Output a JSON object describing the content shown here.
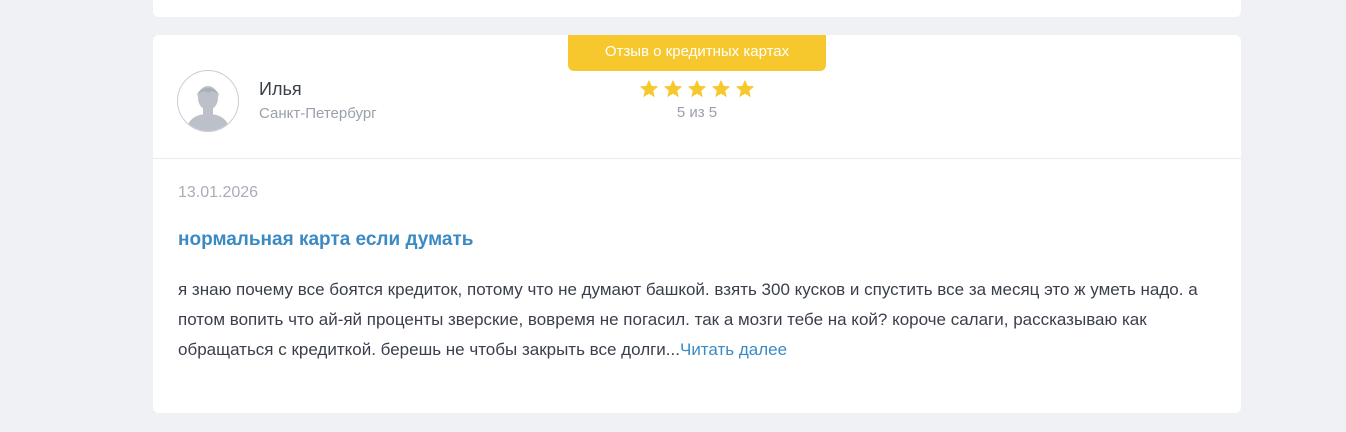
{
  "review": {
    "category_badge": "Отзыв о кредитных картах",
    "author": {
      "name": "Илья",
      "city": "Санкт-Петербург"
    },
    "rating": {
      "value": 5,
      "max": 5,
      "text": "5 из 5",
      "star_color": "#f7c82e"
    },
    "date": "13.01.2026",
    "title": "нормальная карта если думать",
    "excerpt": "я знаю почему все боятся кредиток, потому что не думают башкой. взять 300 кусков и спустить все за месяц это ж уметь надо. а потом вопить что ай-яй проценты зверские, вовремя не погасил. так а мозги тебе на кой? короче салаги, рассказываю как обращаться с кредиткой. берешь не чтобы закрыть все долги...",
    "read_more_label": "Читать далее"
  },
  "colors": {
    "accent_link": "#3a8ac4",
    "badge": "#f7c82e",
    "page_bg": "#f0f1f4"
  }
}
